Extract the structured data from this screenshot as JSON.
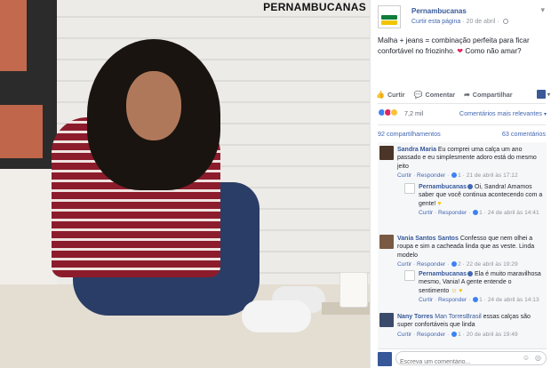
{
  "photo": {
    "brand": "PERNAMBUCANAS"
  },
  "post": {
    "page_name": "Pernambucanas",
    "curtir_pagina": "Curtir esta página",
    "date": "20 de abril",
    "text": "Malha + jeans = combinação perfeita para ficar confortável no friozinho. ",
    "text_after_heart": " Como não amar?",
    "heart_icon": "heart-emoji"
  },
  "actions": {
    "like": "Curtir",
    "comment": "Comentar",
    "share": "Compartilhar"
  },
  "stats": {
    "reactions": "7,2 mil",
    "relevance": "Comentários mais relevantes",
    "shares": "92 compartilhamentos",
    "comments_count": "63 comentários"
  },
  "comments": [
    {
      "name": "Sandra Maria",
      "text": "Eu comprei uma calça um ano passado e eu simplesmente adoro está do mesmo jeito",
      "like": "Curtir",
      "reply": "Responder",
      "likes": "1",
      "date": "21 de abril às 17:12",
      "reply_item": {
        "name": "Pernambucanas",
        "text": "Oi, Sandra! Amamos saber que você continua acontecendo com a gente!",
        "like": "Curtir",
        "reply": "Responder",
        "likes": "1",
        "date": "24 de abril às 14:41"
      }
    },
    {
      "name": "Vania Santos Santos",
      "text": "Confesso que nem olhei a roupa e sim a cacheada linda que as veste. Linda modelo",
      "like": "Curtir",
      "reply": "Responder",
      "likes": "2",
      "date": "22 de abril às 19:29",
      "reply_item": {
        "name": "Pernambucanas",
        "text": "Ela é muito maravilhosa mesmo, Vania! A gente entende o sentimento",
        "like": "Curtir",
        "reply": "Responder",
        "likes": "1",
        "date": "24 de abril às 14:13"
      }
    },
    {
      "name": "Nany Torres",
      "mention": "Man TorresBrasil",
      "text": "essas calças são super confortáveis que linda",
      "like": "Curtir",
      "reply": "Responder",
      "likes": "1",
      "date": "20 de abril às 19:49"
    }
  ],
  "writer": {
    "placeholder": "Escreva um comentário..."
  },
  "colors": {
    "link": "#365899",
    "accent": "#4267b2",
    "brand_green": "#0e7d3a",
    "brand_yellow": "#f2c400"
  }
}
